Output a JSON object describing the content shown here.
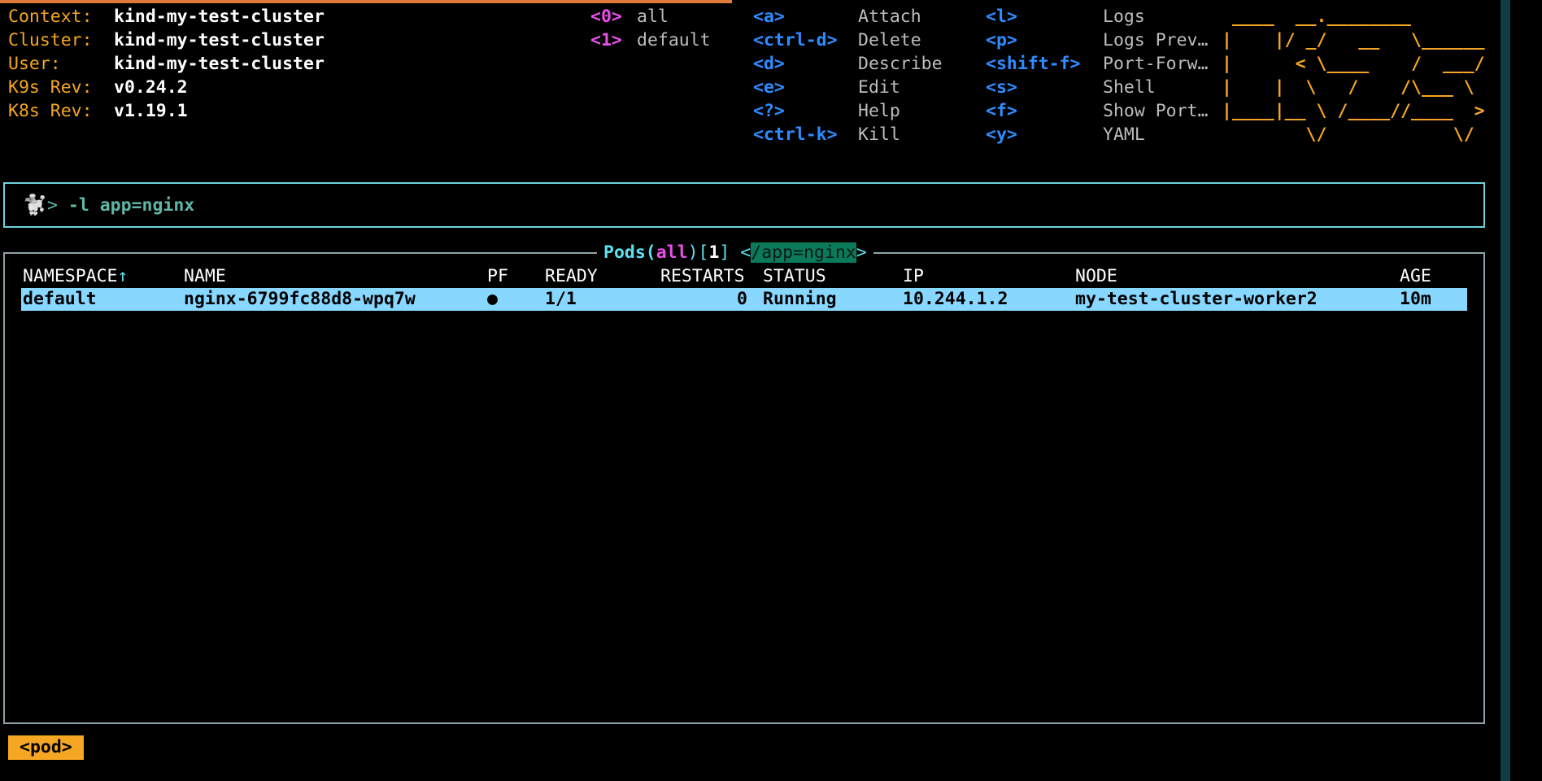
{
  "cluster_info": {
    "context_label": "Context:",
    "context_value": "kind-my-test-cluster",
    "cluster_label": "Cluster:",
    "cluster_value": "kind-my-test-cluster",
    "user_label": "User:",
    "user_value": "kind-my-test-cluster",
    "k9s_label": "K9s Rev:",
    "k9s_value": "v0.24.2",
    "k8s_label": "K8s Rev:",
    "k8s_value": "v1.19.1"
  },
  "namespaces": [
    {
      "key": "<0>",
      "label": "all"
    },
    {
      "key": "<1>",
      "label": "default"
    }
  ],
  "shortcuts_col1": [
    {
      "key": "<a>",
      "label": "Attach"
    },
    {
      "key": "<ctrl-d>",
      "label": "Delete"
    },
    {
      "key": "<d>",
      "label": "Describe"
    },
    {
      "key": "<e>",
      "label": "Edit"
    },
    {
      "key": "<?>",
      "label": "Help"
    },
    {
      "key": "<ctrl-k>",
      "label": "Kill"
    }
  ],
  "shortcuts_col2": [
    {
      "key": "<l>",
      "label": "Logs"
    },
    {
      "key": "<p>",
      "label": "Logs Prev…"
    },
    {
      "key": "<shift-f>",
      "label": "Port-Forw…"
    },
    {
      "key": "<s>",
      "label": "Shell"
    },
    {
      "key": "<f>",
      "label": "Show Port…"
    },
    {
      "key": "<y>",
      "label": "YAML"
    }
  ],
  "logo_lines": [
    " ____  __.________       ",
    "|    |/ _/   __   \\______",
    "|      < \\____    /  ___/",
    "|    |  \\   /    /\\___ \\ ",
    "|____|__ \\ /____//____  >",
    "        \\/            \\/ "
  ],
  "command": {
    "icon": "dog-icon",
    "prompt": ">",
    "text": "-l app=nginx"
  },
  "table": {
    "title_prefix": "Pods(",
    "title_ns": "all",
    "title_mid": ")[",
    "title_count": "1",
    "title_suffix": "] <",
    "title_filter": "/app=nginx",
    "title_end": ">",
    "headers": {
      "namespace": "NAMESPACE",
      "sort_arrow": "↑",
      "name": "NAME",
      "pf": "PF",
      "ready": "READY",
      "restarts": "RESTARTS",
      "status": "STATUS",
      "ip": "IP",
      "node": "NODE",
      "age": "AGE"
    },
    "rows": [
      {
        "namespace": "default",
        "name": "nginx-6799fc88d8-wpq7w",
        "pf": "●",
        "ready": "1/1",
        "restarts": "0",
        "status": "Running",
        "ip": "10.244.1.2",
        "node": "my-test-cluster-worker2",
        "age": "10m"
      }
    ]
  },
  "breadcrumb": "<pod>",
  "colors": {
    "accent_orange": "#f5a623",
    "key_blue": "#2d8cff",
    "key_magenta": "#e94ee9",
    "title_cyan": "#5ee1f0",
    "row_highlight": "#87d7ff",
    "filter_bg": "#0b7a5a"
  }
}
